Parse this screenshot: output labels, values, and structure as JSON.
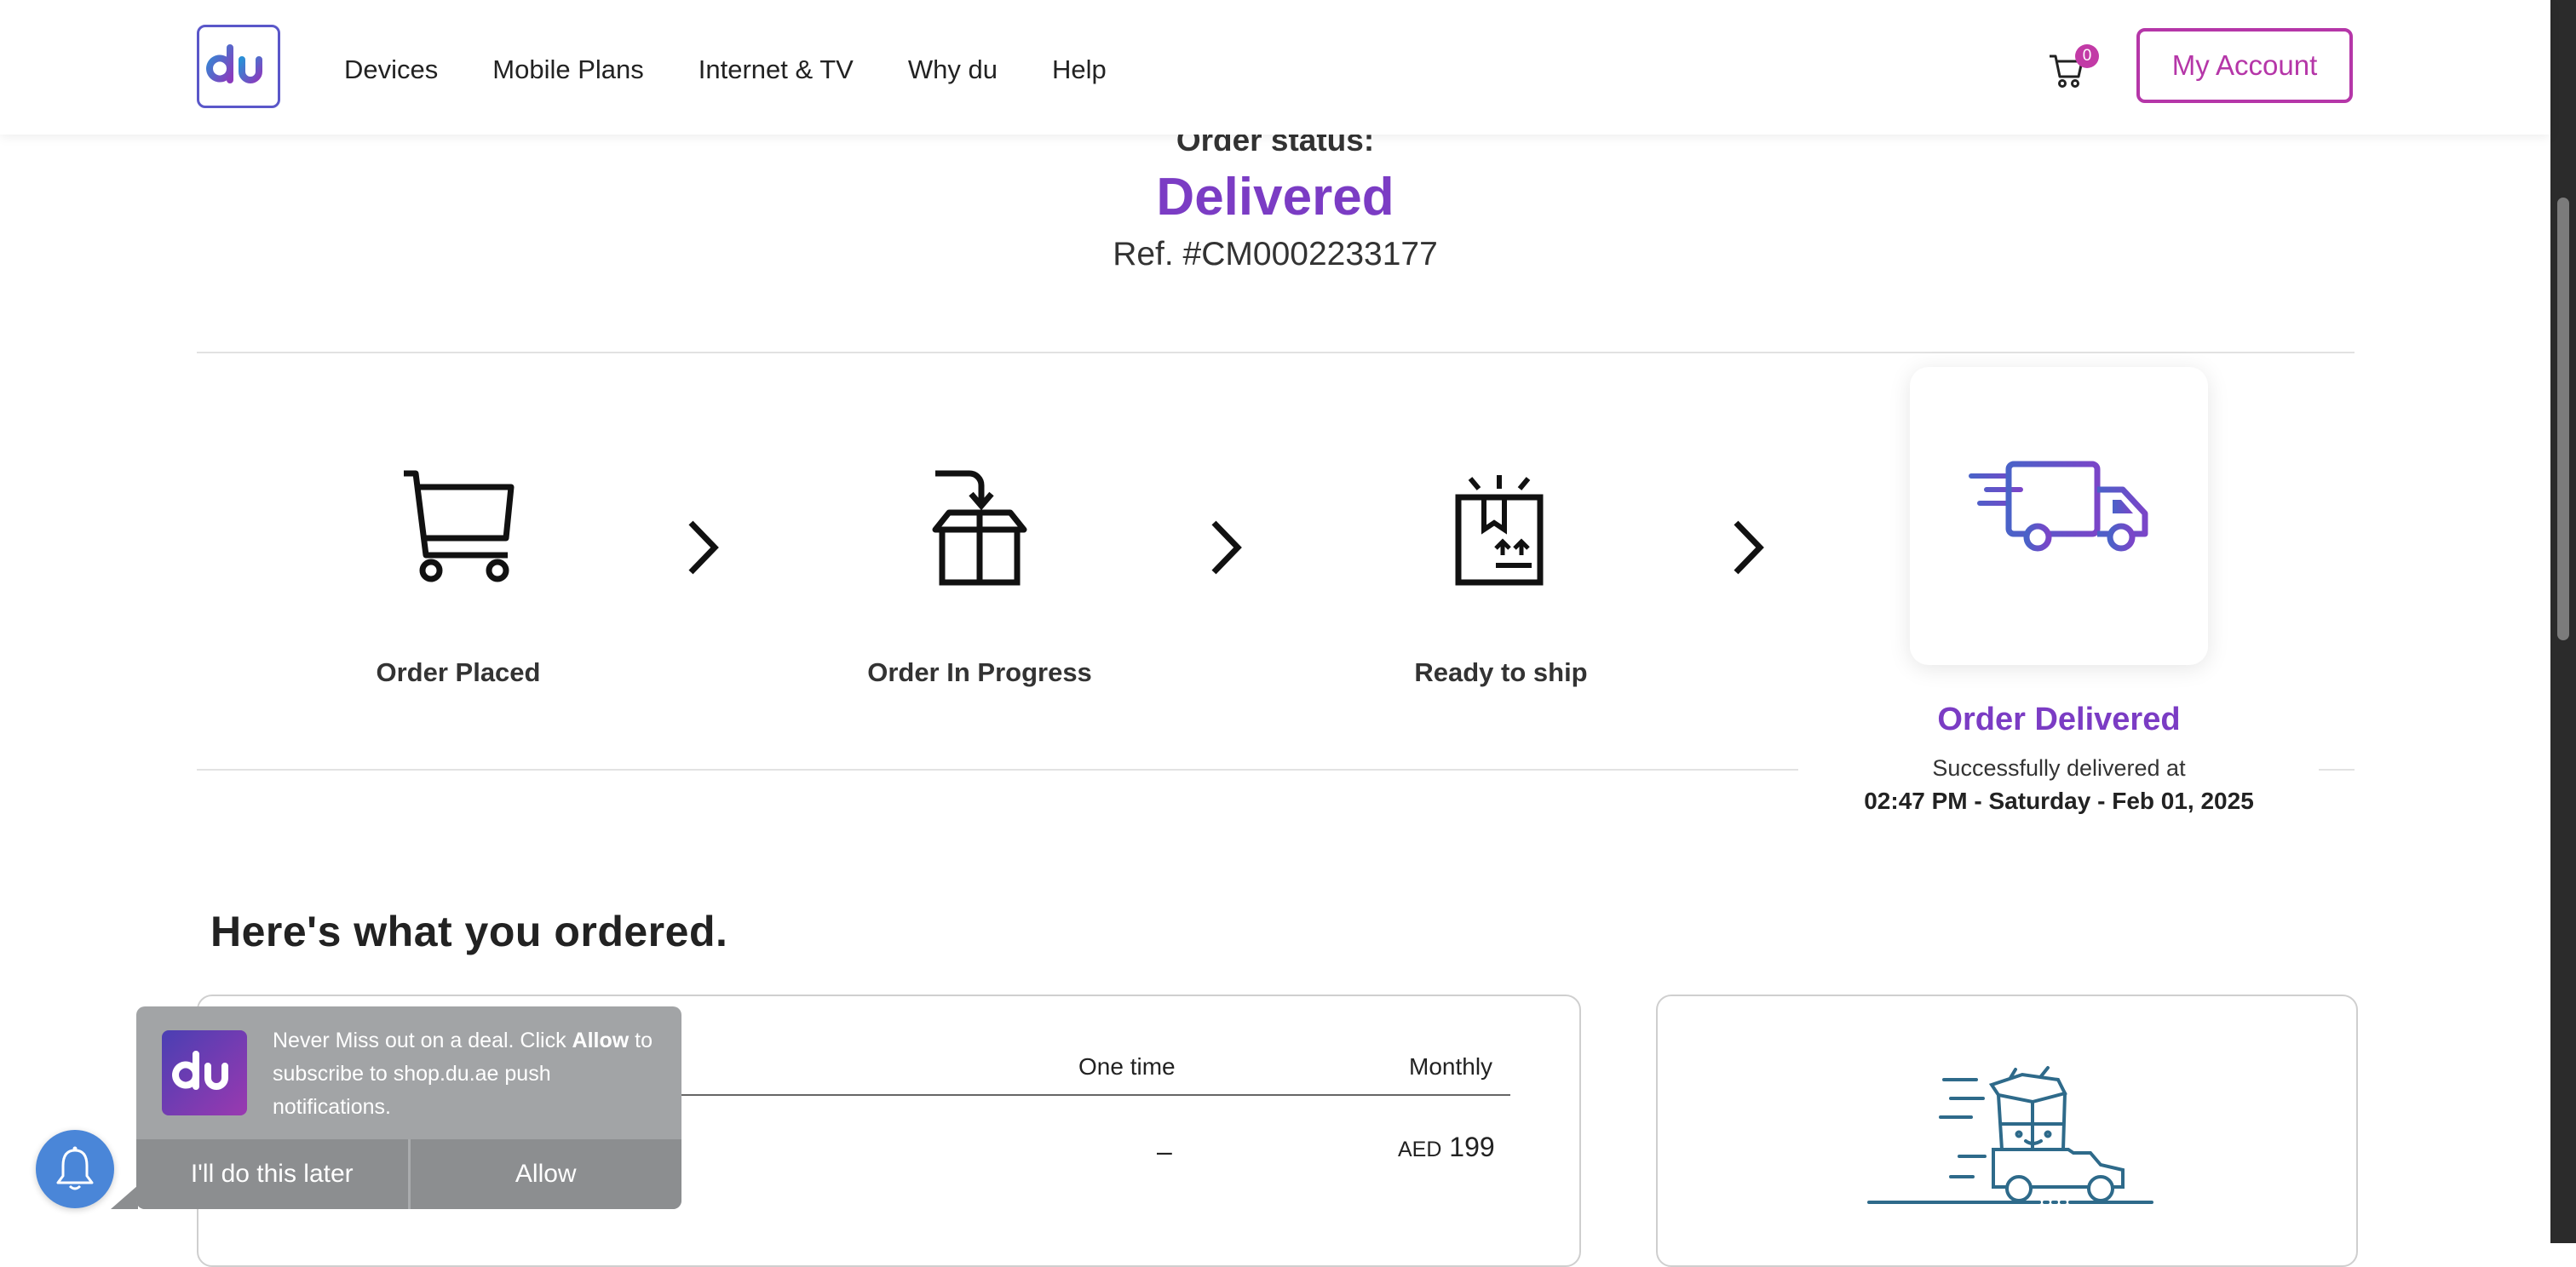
{
  "header": {
    "logo_text": "du",
    "nav": [
      "Devices",
      "Mobile Plans",
      "Internet & TV",
      "Why du",
      "Help"
    ],
    "cart_count": "0",
    "account_label": "My Account"
  },
  "order": {
    "status_label": "Order status:",
    "status_value": "Delivered",
    "ref": "Ref. #CM0002233177"
  },
  "tracker": {
    "steps": [
      {
        "label": "Order Placed",
        "icon": "cart-icon"
      },
      {
        "label": "Order In Progress",
        "icon": "box-icon"
      },
      {
        "label": "Ready to ship",
        "icon": "package-icon"
      },
      {
        "label": "Order Delivered",
        "icon": "truck-icon"
      }
    ],
    "delivered_sub": "Successfully delivered at",
    "delivered_time": "02:47 PM - Saturday - Feb 01, 2025"
  },
  "summary": {
    "title": "Here's what you ordered.",
    "col_onetime": "One time",
    "col_monthly": "Monthly",
    "onetime_value": "–",
    "currency": "AED",
    "monthly_value": "199"
  },
  "push": {
    "text_1": "Never Miss out on a deal. Click ",
    "text_bold": "Allow",
    "text_2": " to subscribe to shop.du.ae push notifications.",
    "later_label": "I'll do this later",
    "allow_label": "Allow"
  },
  "colors": {
    "brand_purple": "#7b3cc4",
    "account_magenta": "#b536a8",
    "bell_blue": "#4a86d8"
  }
}
